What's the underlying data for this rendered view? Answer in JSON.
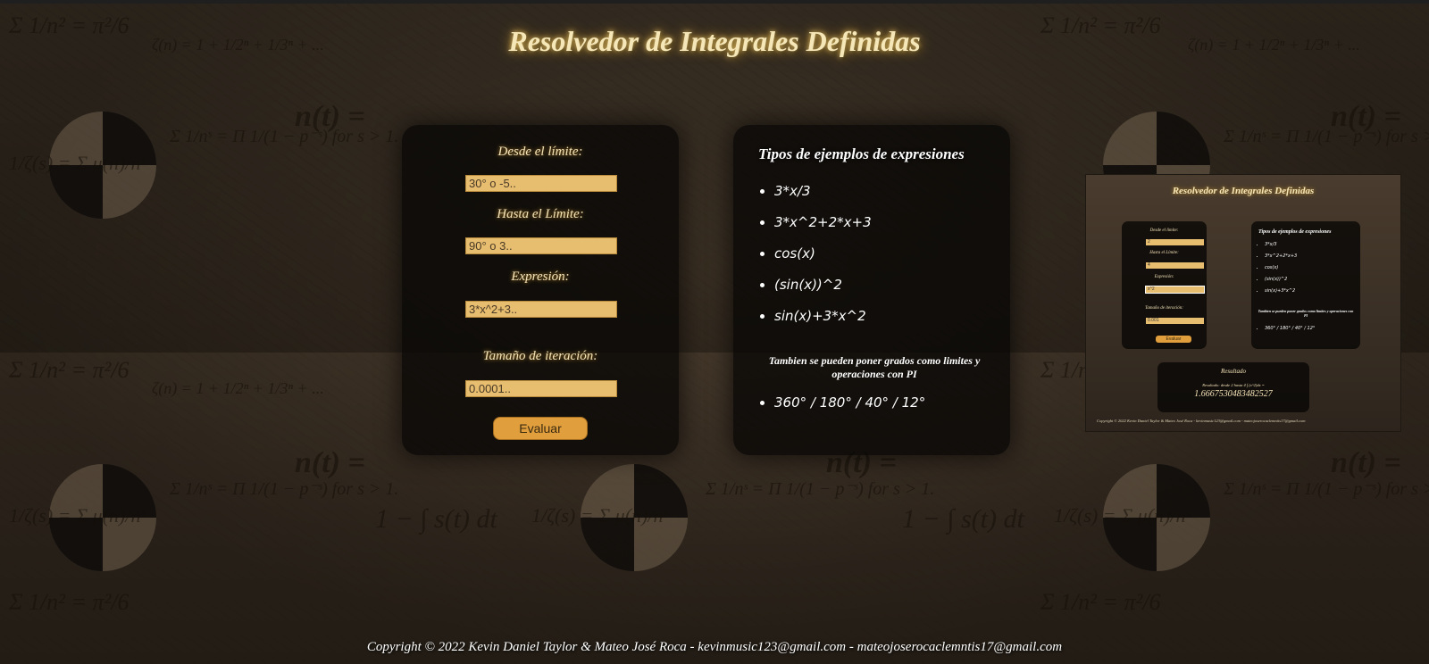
{
  "header": {
    "title": "Resolvedor de Integrales Definidas"
  },
  "form": {
    "from_label": "Desde el límite:",
    "from_placeholder": "30° o -5..",
    "to_label": "Hasta el Límite:",
    "to_placeholder": "90° o 3..",
    "expression_label": "Expresión:",
    "expression_placeholder": "3*x^2+3..",
    "step_label": "Tamaño de iteración:",
    "step_placeholder": "0.0001..",
    "evaluate_label": "Evaluar"
  },
  "examples": {
    "title": "Tipos de ejemplos de expresiones",
    "items": [
      "3*x/3",
      "3*x^2+2*x+3",
      "cos(x)",
      "(sin(x))^2",
      "sin(x)+3*x^2"
    ],
    "note": "Tambien se pueden poner grados como limites y operaciones con PI",
    "degree_example": "360° / 180° / 40° / 12°"
  },
  "preview": {
    "title": "Resolvedor de Integrales Definidas",
    "from_label": "Desde el limite:",
    "from_value": "2",
    "to_label": "Hasta el Límite:",
    "to_value": "4",
    "expression_label": "Expresión:",
    "expression_value": "x^2",
    "step_label": "Tamaño de iteración:",
    "step_value": "0.001",
    "evaluate_label": "Evaluar",
    "examples_title": "Tipos de ejemplos de expresiones",
    "examples_items": [
      "3*x/3",
      "3*x^2+2*x+3",
      "cos(x)",
      "(sin(x))^2",
      "sin(x)+3*x^2"
    ],
    "examples_note": "Tambien se pueden poner grados como limites y operaciones con PI",
    "degree_example": "360° / 180° / 40° / 12°",
    "result_title": "Resultado",
    "result_label": "Resultado: desde 2 hasta 4 ∫ (x^2)dx =",
    "result_value": "1.6667530483482527",
    "copyright": "Copyright © 2022 Kevin Daniel Taylor & Mateo José Roca - kevinmusic123@gmail.com - mateojoserocaclemntis17@gmail.com"
  },
  "footer": {
    "copyright": "Copyright © 2022 Kevin Daniel Taylor & Mateo José Roca - kevinmusic123@gmail.com - mateojoserocaclemntis17@gmail.com"
  },
  "background": {
    "formula_1": "Σ 1/n² = π²/6",
    "formula_2": "ζ(n) = 1 + 1/2ⁿ + 1/3ⁿ + ...",
    "formula_3": "n(t) =",
    "formula_4": "1 − ∫ s(t) dt",
    "formula_5": "Σ 1/nˢ = Π 1/(1 − p⁻ˢ) for s > 1.",
    "formula_6": "1/ζ(s) = Σ μ(n)/nˢ"
  },
  "colors": {
    "accent": "#e7bd70",
    "button": "#e09e3c",
    "title_glow": "#c8962e"
  }
}
